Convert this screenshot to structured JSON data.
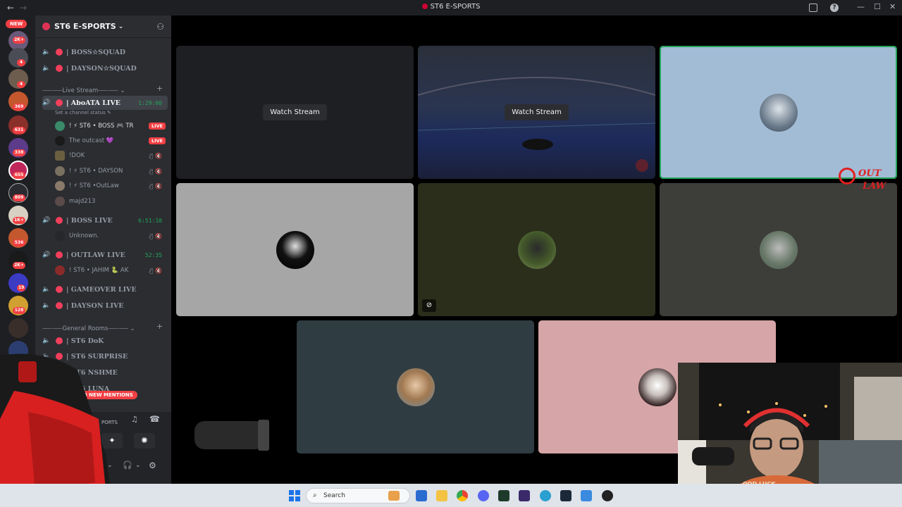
{
  "window": {
    "title": "ST6 E-SPORTS",
    "back_glyph": "←",
    "forward_glyph": "→",
    "minimize_glyph": "—",
    "maximize_glyph": "☐",
    "close_glyph": "✕",
    "help_glyph": "?"
  },
  "server_rail": {
    "new_label": "NEW",
    "badges": [
      "2K+",
      "4",
      "4",
      "369",
      "631",
      "338",
      "655",
      "809",
      "1K+",
      "536",
      "2K+",
      "19",
      "128"
    ]
  },
  "guild": {
    "name": "ST6 E-SPORTS",
    "dropdown_glyph": "⌄",
    "invite_glyph": "⚇"
  },
  "channels_top": [
    {
      "name": "| BOSS☆SQUAD"
    },
    {
      "name": "| DAYSON☆SQUAD"
    }
  ],
  "category_live": "⸺⸺Live Stream⸺⸺",
  "active_channel": {
    "name": "| AboATA LIVE",
    "timer": "1:29:00",
    "status": "Set a channel status ✎"
  },
  "members_abo": [
    {
      "name": "! ⚡ ST6 • BOSS 🎮 TR",
      "live": "LIVE"
    },
    {
      "name": "The outcast 💜",
      "live": "LIVE"
    },
    {
      "name": "!DOK",
      "icons": "🎙̸🔇"
    },
    {
      "name": "! ⚡ ST6 • DAYSON",
      "icons": "🎙̸🔇"
    },
    {
      "name": "! ⚡ ST6 •OutLaw",
      "icons": "🎙̸🔇"
    },
    {
      "name": "majd213",
      "icons": ""
    }
  ],
  "boss_live": {
    "name": "| BOSS LIVE",
    "timer": "6:51:10"
  },
  "boss_member": {
    "name": "Unknown.",
    "icons": "🎙̸🔇"
  },
  "outlaw_live": {
    "name": "| OUTLAW LIVE",
    "timer": "52:35"
  },
  "outlaw_member": {
    "name": "! ST6 • JAHIM 🐍 AK",
    "icons": "🎙̸🔇"
  },
  "channels_mid": [
    {
      "name": "| GAMEOVER LIVE"
    },
    {
      "name": "| DAYSON LIVE"
    }
  ],
  "category_general": "⸺⸺General Rooms⸺⸺",
  "channels_general": [
    {
      "name": "| ST6 DoK"
    },
    {
      "name": "| ST6 SURPRISE"
    },
    {
      "name": "| ST6 NSHME"
    },
    {
      "name": "| ST6 LUNA"
    }
  ],
  "mentions_label": "36 NEW MENTIONS",
  "voice_panel": {
    "server_suffix": "PORTS"
  },
  "stage": {
    "watch_stream_1": "Watch Stream",
    "watch_stream_2": "Watch Stream"
  },
  "taskbar": {
    "search_placeholder": "Search"
  },
  "overlay": {
    "logo_line1": "OUT",
    "logo_line2": "LAW",
    "cap_text": "OOD LUCK"
  },
  "colors": {
    "accent_live": "#23a55a",
    "mention_red": "#f23f43",
    "tile_blue": "#a3bcd6",
    "tile_gray": "#a6a6a6",
    "tile_olive": "#2b2e1b",
    "tile_dark": "#3d3d39",
    "tile_slate": "#2f3c42",
    "tile_pink": "#d6a5a7"
  }
}
